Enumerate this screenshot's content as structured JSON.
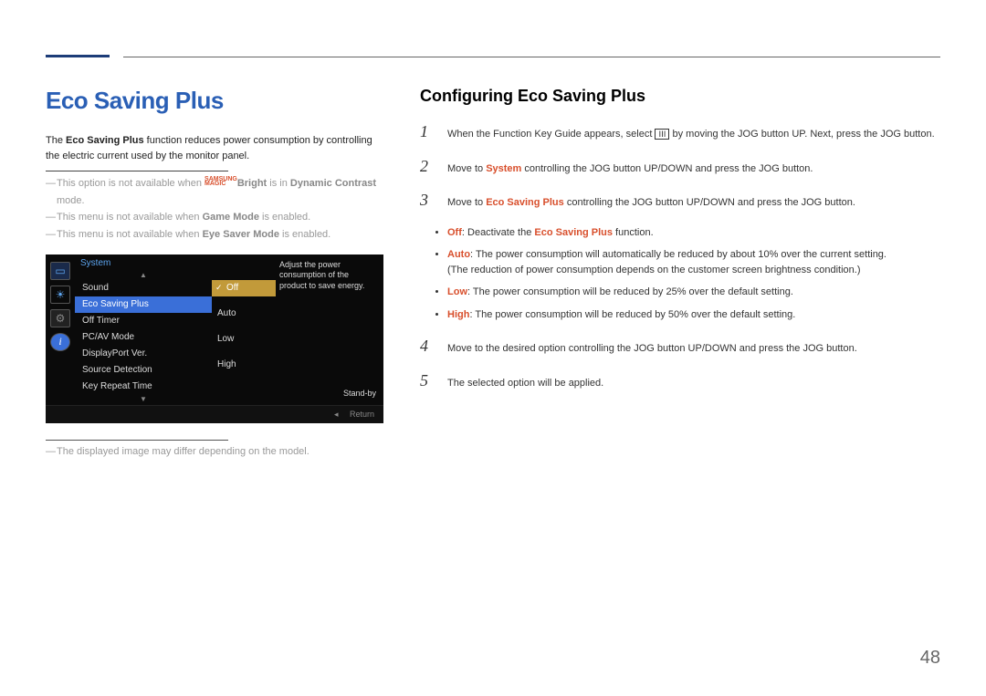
{
  "topbar": {},
  "left": {
    "title": "Eco Saving Plus",
    "desc_prefix": "The ",
    "desc_bold": "Eco Saving Plus",
    "desc_suffix": " function reduces power consumption by controlling the electric current used by the monitor panel.",
    "note1_prefix": "This option is not available when ",
    "note1_magic_top": "SAMSUNG",
    "note1_magic_bot": "MAGIC",
    "note1_bright": "Bright",
    "note1_mid": " is in ",
    "note1_mode": "Dynamic Contrast",
    "note1_suffix": " mode.",
    "note2_prefix": "This menu is not available when ",
    "note2_mode": "Game Mode",
    "note2_suffix": " is enabled.",
    "note3_prefix": "This menu is not available when ",
    "note3_mode": "Eye Saver Mode",
    "note3_suffix": " is enabled.",
    "footer_note": "The displayed image may differ depending on the model."
  },
  "osd": {
    "tab": "System",
    "items": [
      "Sound",
      "Eco Saving Plus",
      "Off Timer",
      "PC/AV Mode",
      "DisplayPort Ver.",
      "Source Detection",
      "Key Repeat Time"
    ],
    "options": [
      "Off",
      "Auto",
      "Low",
      "High"
    ],
    "tooltip": "Adjust the power consumption of the product to save energy.",
    "standby": "Stand-by",
    "footer_return": "Return"
  },
  "right": {
    "title": "Configuring Eco Saving Plus",
    "step1_prefix": "When the Function Key Guide appears, select ",
    "step1_suffix": " by moving the JOG button UP. Next, press the JOG button.",
    "step2_prefix": "Move to ",
    "step2_target": "System",
    "step2_suffix": " controlling the JOG button UP/DOWN and press the JOG button.",
    "step3_prefix": "Move to ",
    "step3_target": "Eco Saving Plus",
    "step3_suffix": " controlling the JOG button UP/DOWN and press the JOG button.",
    "bullet_off_label": "Off",
    "bullet_off_mid": ": Deactivate the ",
    "bullet_off_target": "Eco Saving Plus",
    "bullet_off_suffix": " function.",
    "bullet_auto_label": "Auto",
    "bullet_auto_text": ": The power consumption will automatically be reduced by about 10% over the current setting.",
    "bullet_auto_sub": "(The reduction of power consumption depends on the customer screen brightness condition.)",
    "bullet_low_label": "Low",
    "bullet_low_text": ": The power consumption will be reduced by 25% over the default setting.",
    "bullet_high_label": "High",
    "bullet_high_text": ": The power consumption will be reduced by 50% over the default setting.",
    "step4": "Move to the desired option controlling the JOG button UP/DOWN and press the JOG button.",
    "step5": "The selected option will be applied.",
    "nums": {
      "n1": "1",
      "n2": "2",
      "n3": "3",
      "n4": "4",
      "n5": "5"
    }
  },
  "page_number": "48"
}
